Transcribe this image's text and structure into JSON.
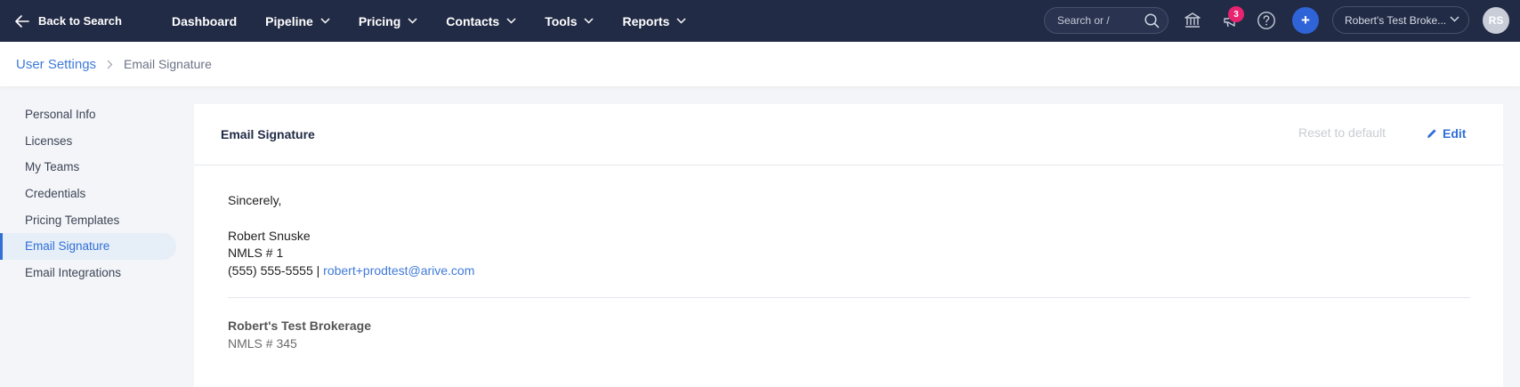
{
  "topbar": {
    "back_label": "Back to Search",
    "nav": [
      {
        "label": "Dashboard",
        "has_dropdown": false
      },
      {
        "label": "Pipeline",
        "has_dropdown": true
      },
      {
        "label": "Pricing",
        "has_dropdown": true
      },
      {
        "label": "Contacts",
        "has_dropdown": true
      },
      {
        "label": "Tools",
        "has_dropdown": true
      },
      {
        "label": "Reports",
        "has_dropdown": true
      }
    ],
    "search_placeholder": "Search or /",
    "notification_count": "3",
    "plus_label": "+",
    "brokerage_label": "Robert's Test Broke...",
    "avatar_initials": "RS",
    "icons": [
      "bank-icon",
      "megaphone-icon",
      "help-icon"
    ]
  },
  "breadcrumb": {
    "parent": "User Settings",
    "current": "Email Signature"
  },
  "sidebar": {
    "items": [
      {
        "label": "Personal Info",
        "active": false
      },
      {
        "label": "Licenses",
        "active": false
      },
      {
        "label": "My Teams",
        "active": false
      },
      {
        "label": "Credentials",
        "active": false
      },
      {
        "label": "Pricing Templates",
        "active": false
      },
      {
        "label": "Email Signature",
        "active": true
      },
      {
        "label": "Email Integrations",
        "active": false
      }
    ]
  },
  "card": {
    "title": "Email Signature",
    "reset_label": "Reset to default",
    "edit_label": "Edit"
  },
  "signature": {
    "closing": "Sincerely,",
    "name": "Robert Snuske",
    "nmls": "NMLS # 1",
    "phone": "(555) 555-5555 |",
    "email": "robert+prodtest@arive.com",
    "brokerage_name": "Robert's Test Brokerage",
    "brokerage_nmls": "NMLS # 345"
  },
  "colors": {
    "topbar_bg": "#222b45",
    "accent": "#2f6fd6",
    "badge": "#e8236f"
  }
}
